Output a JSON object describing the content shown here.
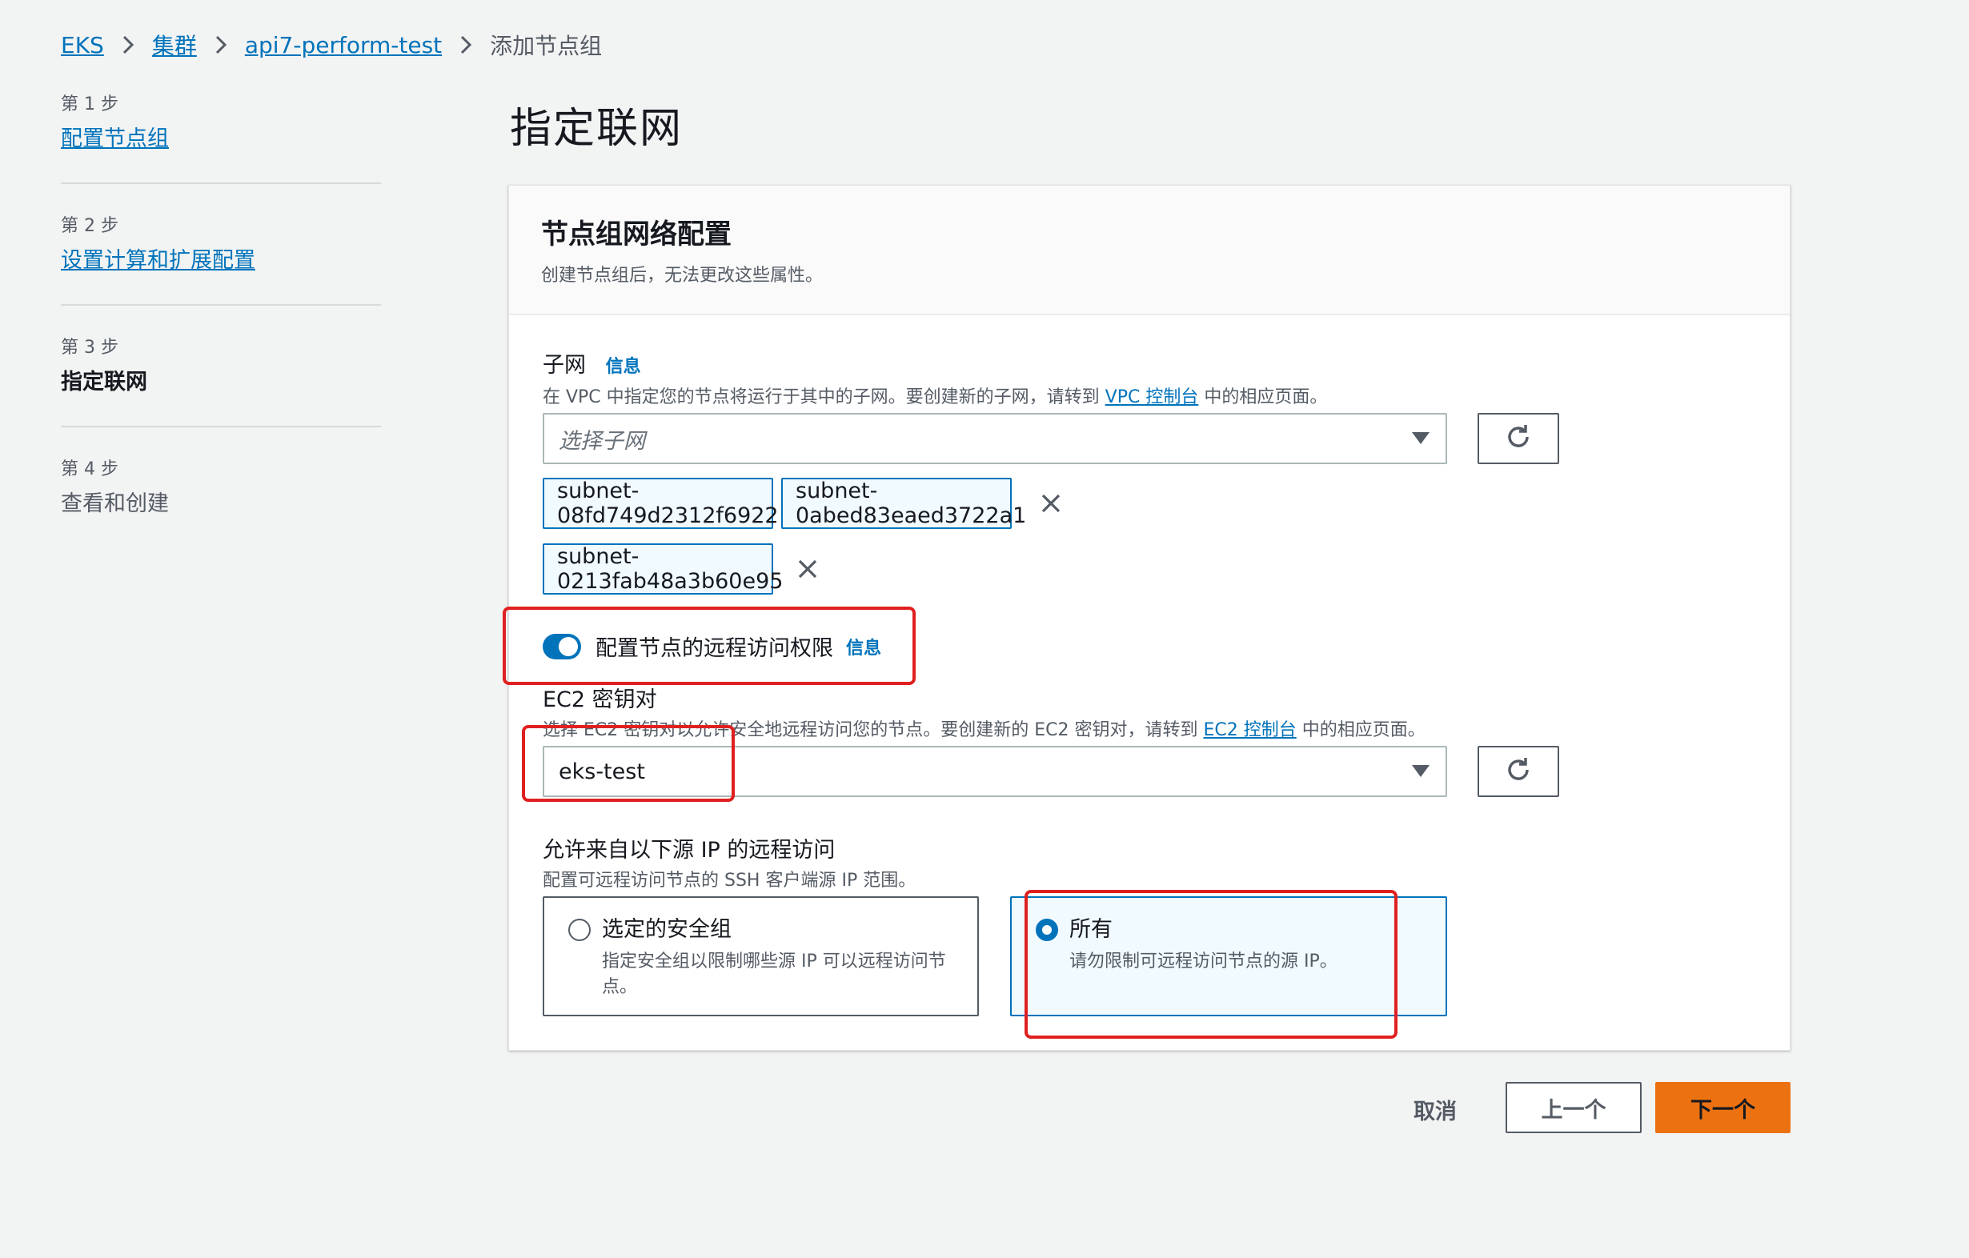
{
  "breadcrumb": {
    "items": [
      "EKS",
      "集群",
      "api7-perform-test"
    ],
    "current": "添加节点组"
  },
  "steps": [
    {
      "num": "第 1 步",
      "label": "配置节点组"
    },
    {
      "num": "第 2 步",
      "label": "设置计算和扩展配置"
    },
    {
      "num": "第 3 步",
      "label": "指定联网"
    },
    {
      "num": "第 4 步",
      "label": "查看和创建"
    }
  ],
  "page_title": "指定联网",
  "card": {
    "title": "节点组网络配置",
    "description": "创建节点组后，无法更改这些属性。"
  },
  "subnet": {
    "label": "子网",
    "info": "信息",
    "desc_before": "在 VPC 中指定您的节点将运行于其中的子网。要创建新的子网，请转到 ",
    "desc_link": "VPC 控制台",
    "desc_after": " 中的相应页面。",
    "placeholder": "选择子网",
    "tokens": [
      "subnet-08fd749d2312f6922",
      "subnet-0abed83eaed3722a1",
      "subnet-0213fab48a3b60e95"
    ]
  },
  "remote_access": {
    "toggle_label": "配置节点的远程访问权限",
    "info": "信息",
    "enabled": true
  },
  "keypair": {
    "label": "EC2 密钥对",
    "desc_before": "选择 EC2 密钥对以允许安全地远程访问您的节点。要创建新的 EC2 密钥对，请转到 ",
    "desc_link": "EC2 控制台",
    "desc_after": " 中的相应页面。",
    "value": "eks-test"
  },
  "source_ip": {
    "label": "允许来自以下源 IP 的远程访问",
    "desc": "配置可远程访问节点的 SSH 客户端源 IP 范围。",
    "options": [
      {
        "title": "选定的安全组",
        "desc": "指定安全组以限制哪些源 IP 可以远程访问节点。",
        "selected": false
      },
      {
        "title": "所有",
        "desc": "请勿限制可远程访问节点的源 IP。",
        "selected": true
      }
    ]
  },
  "footer": {
    "cancel": "取消",
    "previous": "上一个",
    "next": "下一个"
  },
  "colors": {
    "link": "#0073bb",
    "primary_button": "#ec7211",
    "annotation": "#e02020"
  }
}
